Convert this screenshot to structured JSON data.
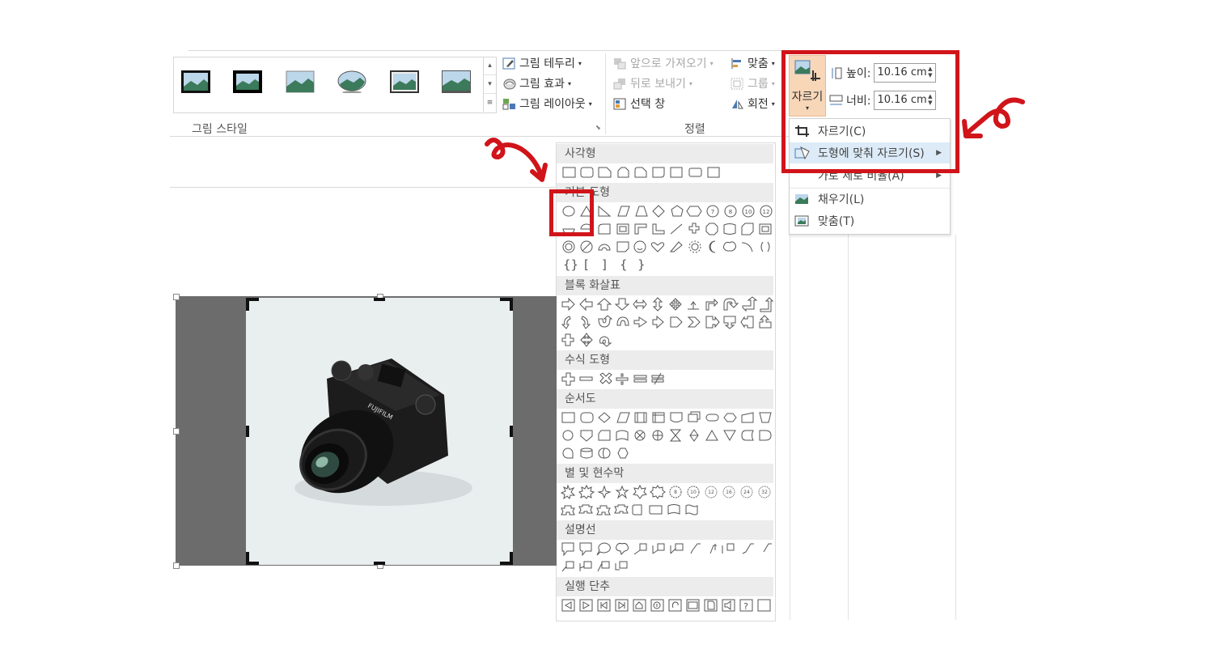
{
  "ribbon": {
    "picture_border_label": "그림 테두리",
    "picture_effects_label": "그림 효과",
    "picture_layout_label": "그림 레이아웃",
    "picture_styles_group": "그림 스타일",
    "bring_forward_label": "앞으로 가져오기",
    "send_backward_label": "뒤로 보내기",
    "selection_pane_label": "선택 창",
    "align_label": "맞춤",
    "group_label": "그룹",
    "rotate_label": "회전",
    "arrange_group": "정렬",
    "crop_label": "자르기",
    "height_label": "높이:",
    "height_value": "10.16 cm",
    "width_label": "너비:",
    "width_value": "10.16 cm"
  },
  "crop_menu": {
    "items": [
      {
        "label": "자르기(C)"
      },
      {
        "label": "도형에 맞춰 자르기(S)"
      },
      {
        "label": "가로 세로 비율(A)"
      },
      {
        "label": "채우기(L)"
      },
      {
        "label": "맞춤(T)"
      }
    ]
  },
  "shapes": {
    "sections": [
      "사각형",
      "기본 도형",
      "블록 화살표",
      "수식 도형",
      "순서도",
      "별 및 현수막",
      "설명선",
      "실행 단추"
    ]
  },
  "picture": {
    "brand_text": "FUJIFILM"
  },
  "colors": {
    "highlight_red": "#d0141a",
    "crop_button_bg": "#f7d7b8",
    "menu_hover": "#dcebf7"
  }
}
